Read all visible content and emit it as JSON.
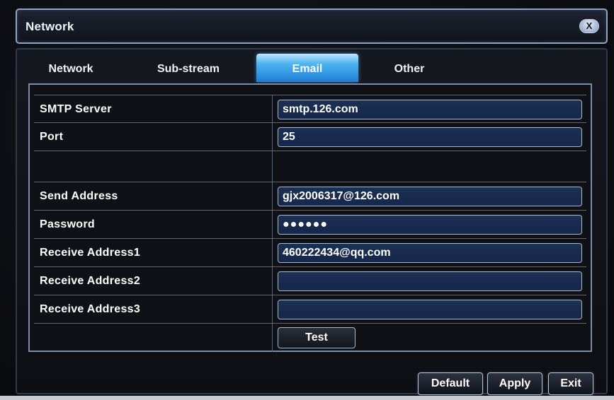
{
  "window": {
    "title": "Network",
    "close_label": "X"
  },
  "tabs": [
    {
      "label": "Network",
      "active": false
    },
    {
      "label": "Sub-stream",
      "active": false
    },
    {
      "label": "Email",
      "active": true
    },
    {
      "label": "Other",
      "active": false
    }
  ],
  "form": {
    "smtp_server": {
      "label": "SMTP Server",
      "value": "smtp.126.com"
    },
    "port": {
      "label": "Port",
      "value": "25"
    },
    "send_address": {
      "label": "Send Address",
      "value": "gjx2006317@126.com"
    },
    "password": {
      "label": "Password",
      "value": "●●●●●●"
    },
    "receive_address1": {
      "label": "Receive Address1",
      "value": "460222434@qq.com"
    },
    "receive_address2": {
      "label": "Receive Address2",
      "value": ""
    },
    "receive_address3": {
      "label": "Receive Address3",
      "value": ""
    },
    "test_label": "Test"
  },
  "footer": {
    "default_label": "Default",
    "apply_label": "Apply",
    "exit_label": "Exit"
  },
  "colors": {
    "active_tab": "#2a8fe0",
    "field_bg": "#1b3052",
    "border": "#8fa3c4"
  }
}
